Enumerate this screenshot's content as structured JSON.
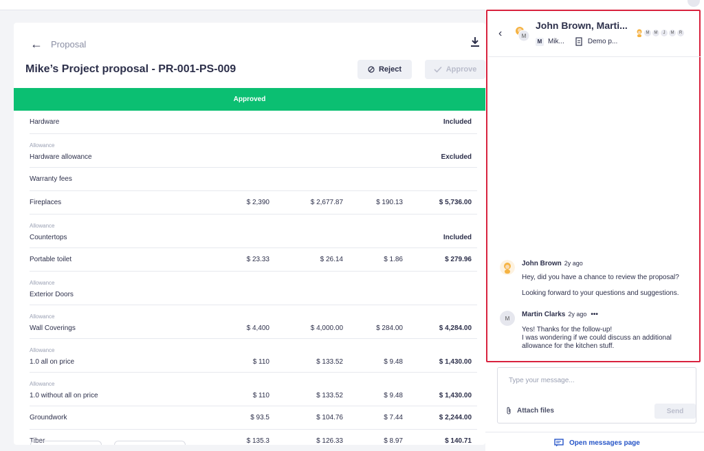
{
  "proposal": {
    "breadcrumb": "Proposal",
    "title": "Mike’s Project proposal - PR-001-PS-009",
    "reject_label": "Reject",
    "approve_label": "Approve",
    "status_banner": "Approved",
    "rows": [
      {
        "sub": "",
        "name": "Hardware",
        "c1": "",
        "c2": "",
        "c3": "",
        "c4": "Included"
      },
      {
        "sub": "Allowance",
        "name": "Hardware allowance",
        "c1": "",
        "c2": "",
        "c3": "",
        "c4": "Excluded"
      },
      {
        "sub": "",
        "name": "Warranty fees",
        "c1": "",
        "c2": "",
        "c3": "",
        "c4": ""
      },
      {
        "sub": "",
        "name": "Fireplaces",
        "c1": "$ 2,390",
        "c2": "$ 2,677.87",
        "c3": "$ 190.13",
        "c4": "$ 5,736.00"
      },
      {
        "sub": "Allowance",
        "name": "Countertops",
        "c1": "",
        "c2": "",
        "c3": "",
        "c4": "Included"
      },
      {
        "sub": "",
        "name": "Portable toilet",
        "c1": "$ 23.33",
        "c2": "$ 26.14",
        "c3": "$ 1.86",
        "c4": "$ 279.96"
      },
      {
        "sub": "Allowance",
        "name": "Exterior Doors",
        "c1": "",
        "c2": "",
        "c3": "",
        "c4": ""
      },
      {
        "sub": "Allowance",
        "name": "Wall Coverings",
        "c1": "$ 4,400",
        "c2": "$ 4,000.00",
        "c3": "$ 284.00",
        "c4": "$ 4,284.00"
      },
      {
        "sub": "Allowance",
        "name": "1.0 all on price",
        "c1": "$ 110",
        "c2": "$ 133.52",
        "c3": "$ 9.48",
        "c4": "$ 1,430.00"
      },
      {
        "sub": "Allowance",
        "name": "1.0 without all on price",
        "c1": "$ 110",
        "c2": "$ 133.52",
        "c3": "$ 9.48",
        "c4": "$ 1,430.00"
      },
      {
        "sub": "",
        "name": "Groundwork",
        "c1": "$ 93.5",
        "c2": "$ 104.76",
        "c3": "$ 7.44",
        "c4": "$ 2,244.00"
      },
      {
        "sub": "",
        "name": "Tiber",
        "c1": "$ 135.3",
        "c2": "$ 126.33",
        "c3": "$ 8.97",
        "c4": "$ 140.71"
      }
    ]
  },
  "chat": {
    "title": "John Brown, Marti...",
    "meta_badge": "M",
    "meta_user": "Mik...",
    "meta_project": "Demo p...",
    "participants": [
      "M",
      "M",
      "J",
      "M",
      "R"
    ],
    "messages": [
      {
        "author": "John Brown",
        "time": "2y ago",
        "avatar": "",
        "lines": [
          "Hey, did you have a chance to review the proposal?",
          "Looking forward to your questions and suggestions."
        ]
      },
      {
        "author": "Martin Clarks",
        "time": "2y ago",
        "avatar": "M",
        "more": "•••",
        "lines": [
          "Yes! Thanks for the follow-up!",
          "I was wondering if we could discuss an additional",
          "allowance for the kitchen stuff."
        ]
      }
    ],
    "input_placeholder": "Type your message...",
    "attach_label": "Attach files",
    "send_label": "Send",
    "open_messages_label": "Open messages page"
  },
  "colors": {
    "approved_banner": "#0bbf72",
    "highlight_frame": "#d8213d",
    "link": "#2554c7"
  }
}
